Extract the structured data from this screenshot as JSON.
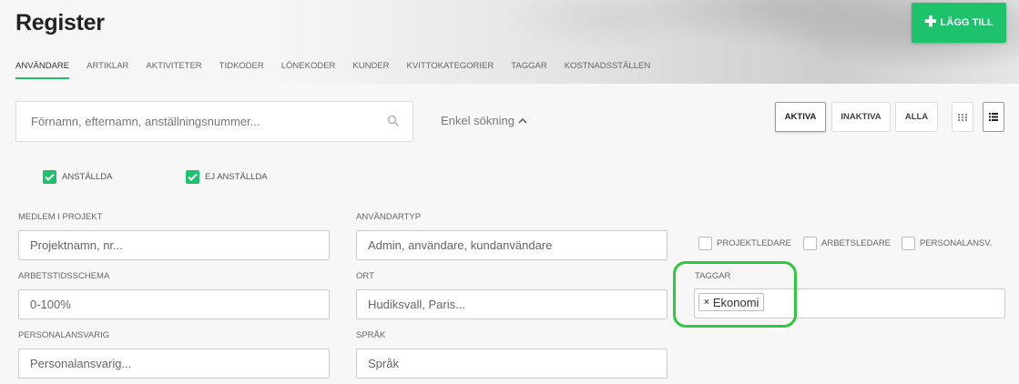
{
  "header": {
    "title": "Register",
    "add_button_label": "LÄGG TILL"
  },
  "tabs": [
    {
      "label": "ANVÄNDARE",
      "active": true
    },
    {
      "label": "ARTIKLAR"
    },
    {
      "label": "AKTIVITETER"
    },
    {
      "label": "TIDKODER"
    },
    {
      "label": "LÖNEKODER"
    },
    {
      "label": "KUNDER"
    },
    {
      "label": "KVITTOKATEGORIER"
    },
    {
      "label": "TAGGAR"
    },
    {
      "label": "KOSTNADSSTÄLLEN"
    }
  ],
  "search": {
    "placeholder": "Förnamn, efternamn, anställningsnummer...",
    "simple_search_label": "Enkel sökning"
  },
  "status_filter": {
    "active": "AKTIVA",
    "inactive": "INAKTIVA",
    "all": "ALLA",
    "selected": "AKTIVA"
  },
  "employment_filter": {
    "employed": "ANSTÄLLDA",
    "not_employed": "EJ ANSTÄLLDA"
  },
  "fields": {
    "project_member": {
      "label": "MEDLEM I PROJEKT",
      "placeholder": "Projektnamn, nr..."
    },
    "user_type": {
      "label": "ANVÄNDARTYP",
      "placeholder": "Admin, användare, kundanvändare"
    },
    "work_schedule": {
      "label": "ARBETSTIDSSCHEMA",
      "placeholder": "0-100%"
    },
    "city": {
      "label": "ORT",
      "placeholder": "Hudiksvall, Paris..."
    },
    "tags": {
      "label": "TAGGAR",
      "values": [
        "Ekonomi"
      ]
    },
    "personnel_manager": {
      "label": "PERSONALANSVARIG",
      "placeholder": "Personalansvarig..."
    },
    "language": {
      "label": "SPRÅK",
      "placeholder": "Språk"
    }
  },
  "roles": {
    "project_manager": "PROJEKTLEDARE",
    "work_manager": "ARBETSLEDARE",
    "personnel_resp": "PERSONALANSV."
  },
  "colors": {
    "accent": "#1ec26c",
    "highlight": "#2dc93f"
  }
}
